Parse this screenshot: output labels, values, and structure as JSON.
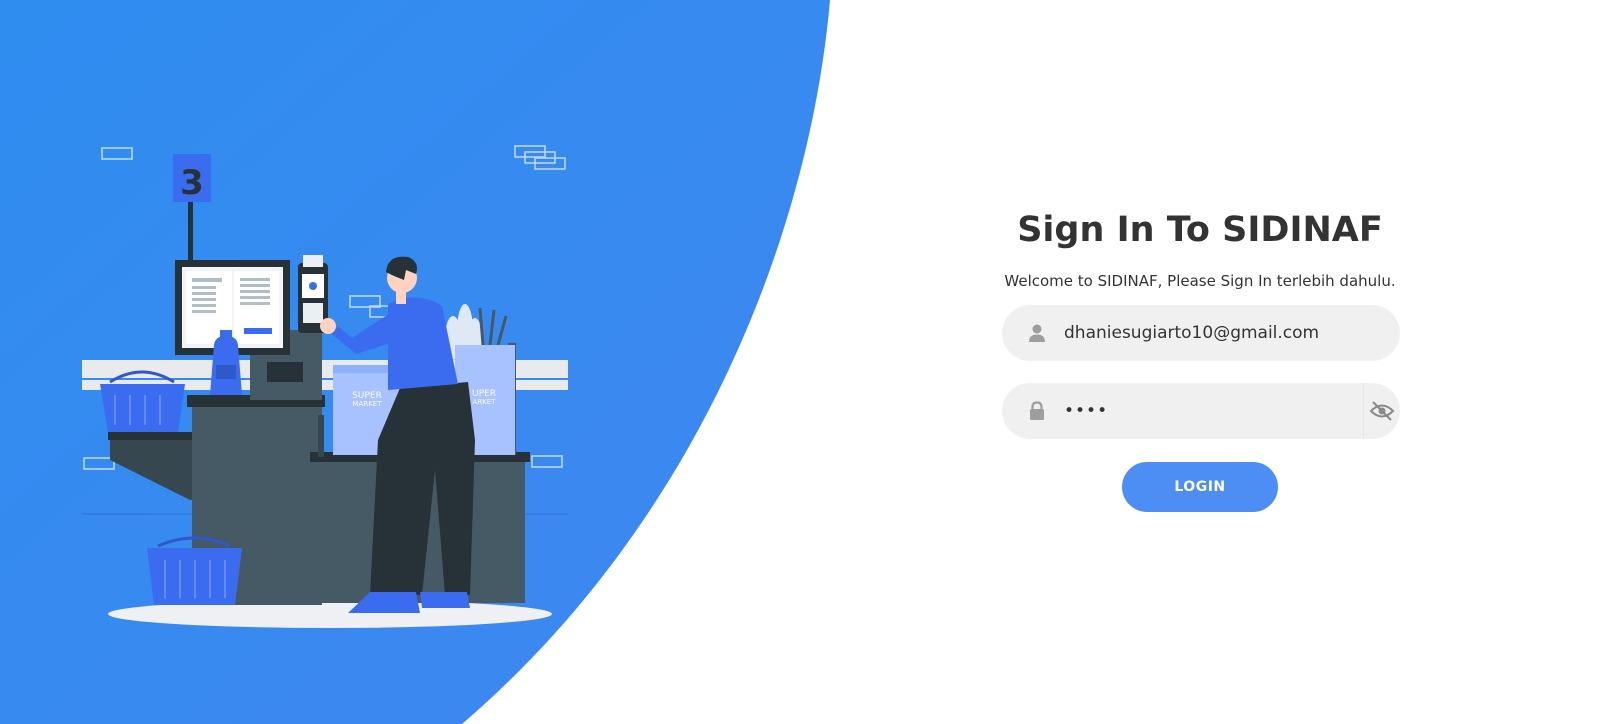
{
  "login": {
    "title": "Sign In To SIDINAF",
    "subtitle": "Welcome to SIDINAF, Please Sign In terlebih dahulu.",
    "email": {
      "value": "dhaniesugiarto10@gmail.com",
      "icon": "user-icon"
    },
    "password": {
      "value": "••••",
      "icon": "lock-icon",
      "toggle_icon": "eye-slash-icon"
    },
    "login_label": "LOGIN"
  },
  "illustration": {
    "counter_number": "3",
    "bag_text_line1": "SUPER",
    "bag_text_line2": "MARKET",
    "bag2_text_line1": "UPER",
    "bag2_text_line2": "ARKET"
  },
  "colors": {
    "hero_blue": "#3a8fee",
    "button_blue": "#4d8ef5",
    "field_bg": "#f0f0f0",
    "text_dark": "#333333"
  }
}
